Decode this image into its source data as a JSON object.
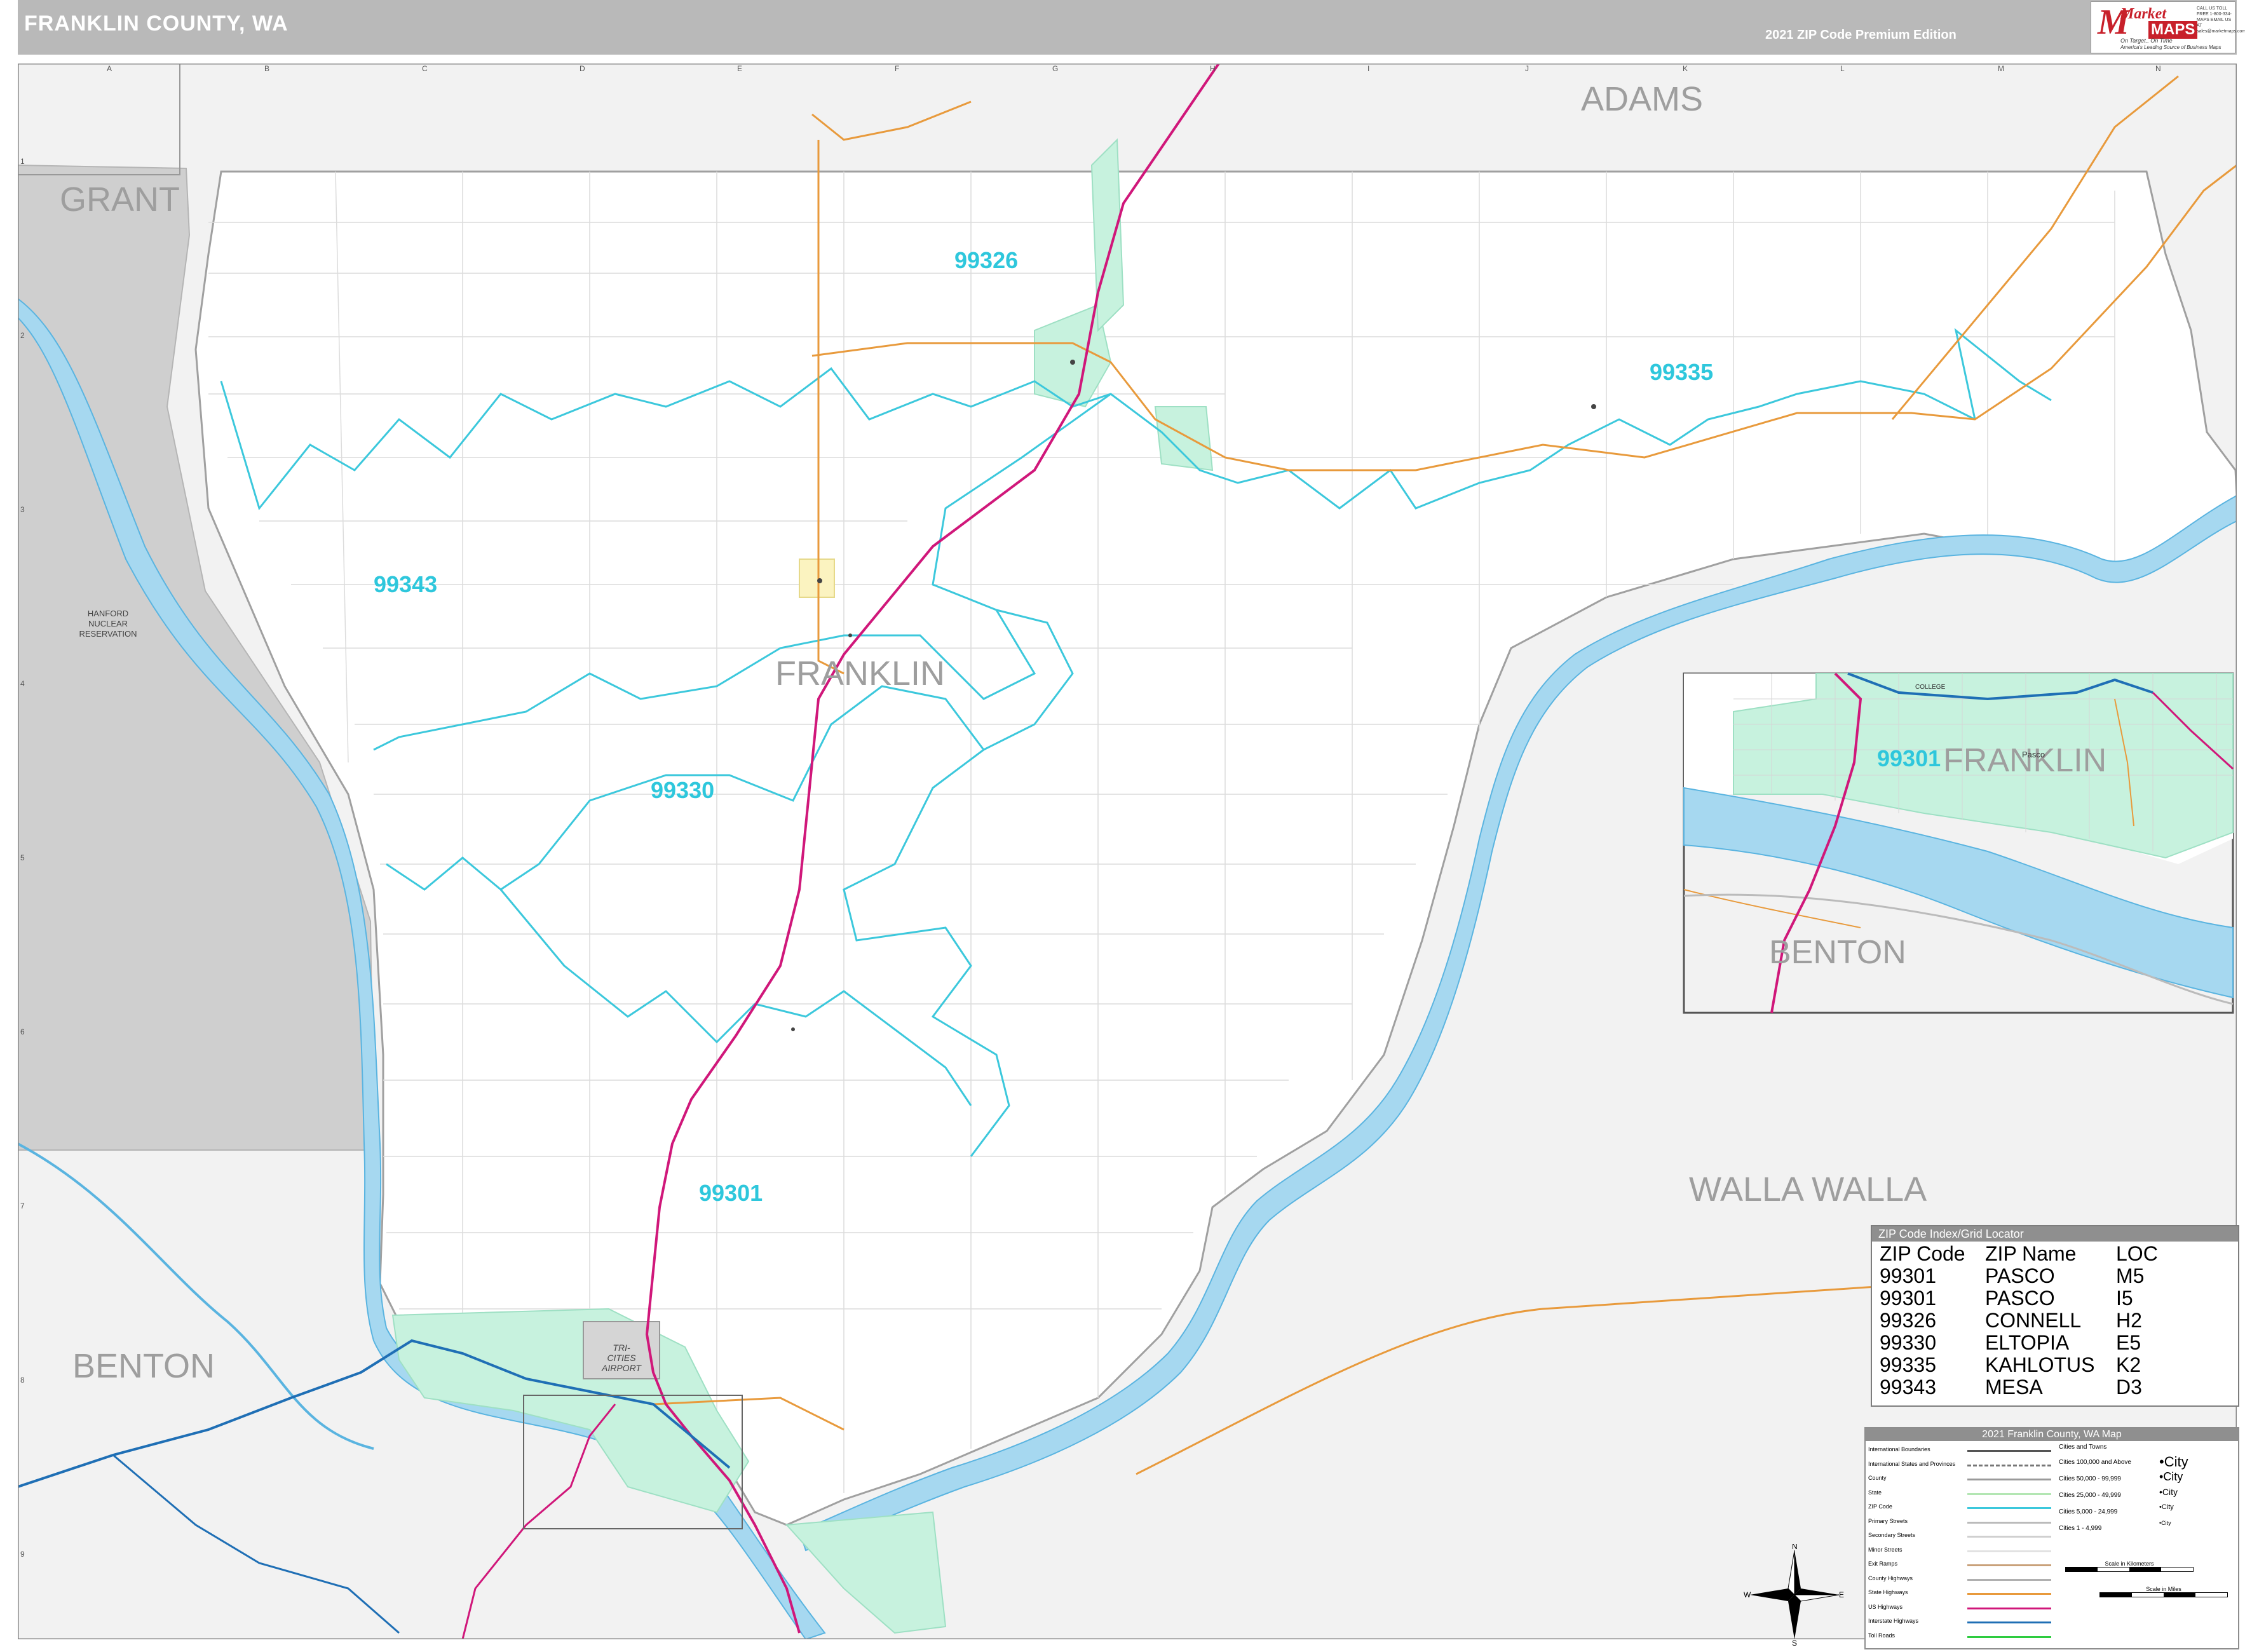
{
  "header": {
    "title": "FRANKLIN COUNTY, WA",
    "edition": "2021 ZIP Code Premium Edition"
  },
  "logo": {
    "market": "Market",
    "maps": "MAPS",
    "tagline1": "On Target.. On Time",
    "tagline2": "America's Leading Source of Business Maps",
    "contact": "CALL US TOLL FREE 1-800-334-MAPS EMAIL US AT sales@marketmaps.com"
  },
  "grid": {
    "columns": [
      "A",
      "B",
      "C",
      "D",
      "E",
      "F",
      "G",
      "H",
      "I",
      "J",
      "K",
      "L",
      "M",
      "N"
    ],
    "rows": [
      "1",
      "2",
      "3",
      "4",
      "5",
      "6",
      "7",
      "8",
      "9"
    ]
  },
  "counties": {
    "adams": "ADAMS",
    "grant": "GRANT",
    "franklin": "FRANKLIN",
    "walla_walla": "WALLA WALLA",
    "benton": "BENTON"
  },
  "reservation": [
    "HANFORD",
    "NUCLEAR",
    "RESERVATION"
  ],
  "zips": {
    "z99326": "99326",
    "z99335": "99335",
    "z99343": "99343",
    "z99330": "99330",
    "z99301": "99301"
  },
  "airport": [
    "TRI-",
    "CITIES",
    "AIRPORT"
  ],
  "inset": {
    "franklin": "FRANKLIN",
    "benton": "BENTON",
    "zip": "99301",
    "city": "Pasco",
    "college": "COLLEGE"
  },
  "zip_index": {
    "title": "ZIP Code Index/Grid Locator",
    "headers": [
      "ZIP Code",
      "ZIP Name",
      "LOC"
    ],
    "rows": [
      [
        "99301",
        "PASCO",
        "M5"
      ],
      [
        "99301",
        "PASCO",
        "I5"
      ],
      [
        "99326",
        "CONNELL",
        "H2"
      ],
      [
        "99330",
        "ELTOPIA",
        "E5"
      ],
      [
        "99335",
        "KAHLOTUS",
        "K2"
      ],
      [
        "99343",
        "MESA",
        "D3"
      ]
    ]
  },
  "legend": {
    "title": "2021 Franklin County, WA Map",
    "lines": [
      {
        "label": "International Boundaries",
        "color": "#555555",
        "style": "solid"
      },
      {
        "label": "International States and Provinces",
        "color": "#777777",
        "style": "dashed"
      },
      {
        "label": "County",
        "color": "#9a9a9a",
        "style": "solid"
      },
      {
        "label": "State",
        "color": "#b3e6b3",
        "style": "solid"
      },
      {
        "label": "ZIP Code",
        "color": "#3cc8dc",
        "style": "solid"
      },
      {
        "label": "Primary Streets",
        "color": "#bbbbbb",
        "style": "solid"
      },
      {
        "label": "Secondary Streets",
        "color": "#d0d0d0",
        "style": "solid"
      },
      {
        "label": "Minor Streets",
        "color": "#e2e2e2",
        "style": "solid"
      },
      {
        "label": "Exit Ramps",
        "color": "#c9a17a",
        "style": "solid"
      },
      {
        "label": "County Highways",
        "color": "#b0b0b0",
        "style": "solid"
      },
      {
        "label": "State Highways",
        "color": "#e89a3c",
        "style": "solid"
      },
      {
        "label": "US Highways",
        "color": "#d0177a",
        "style": "solid"
      },
      {
        "label": "Interstate Highways",
        "color": "#1f6fb5",
        "style": "solid"
      },
      {
        "label": "Toll Roads",
        "color": "#2ecc40",
        "style": "solid"
      }
    ],
    "cities_title": "Cities and Towns",
    "cities": [
      {
        "label": "Cities 100,000 and Above",
        "sample": "City"
      },
      {
        "label": "Cities 50,000 - 99,999",
        "sample": "City"
      },
      {
        "label": "Cities 25,000 - 49,999",
        "sample": "City"
      },
      {
        "label": "Cities 5,000 - 24,999",
        "sample": "City"
      },
      {
        "label": "Cities 1 - 4,999",
        "sample": "City"
      }
    ],
    "scale_km": "Scale in Kilometers",
    "scale_mi": "Scale in Miles"
  },
  "compass": {
    "n": "N",
    "s": "S",
    "e": "E",
    "w": "W"
  },
  "colors": {
    "water": "#a6d8f0",
    "river_outline": "#5ab4e0",
    "zip_boundary": "#3cc8dc",
    "us_highway": "#d0177a",
    "interstate": "#1f6fb5",
    "state_highway": "#e89a3c",
    "urban": "#c7f2de",
    "outside_county": "#f2f2f2",
    "reservation": "#cfcfcf"
  }
}
